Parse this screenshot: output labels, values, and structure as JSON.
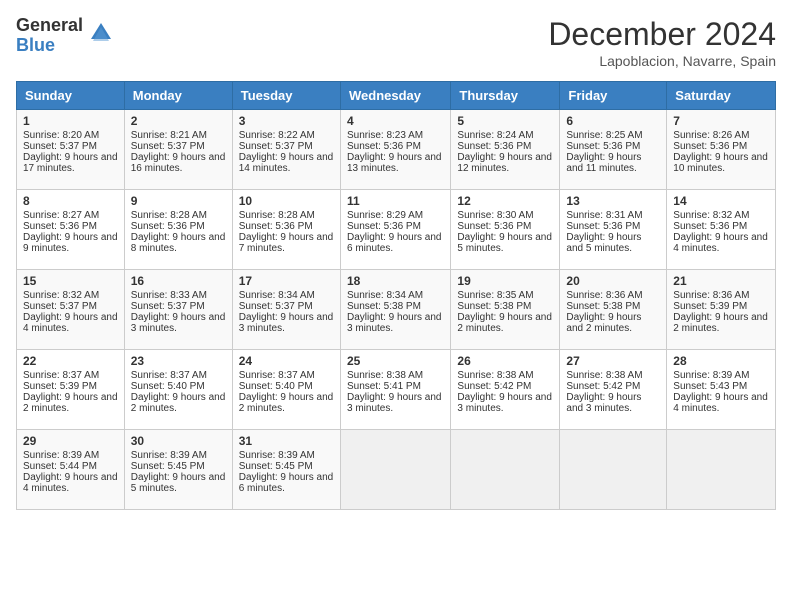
{
  "logo": {
    "general": "General",
    "blue": "Blue"
  },
  "header": {
    "month": "December 2024",
    "location": "Lapoblacion, Navarre, Spain"
  },
  "weekdays": [
    "Sunday",
    "Monday",
    "Tuesday",
    "Wednesday",
    "Thursday",
    "Friday",
    "Saturday"
  ],
  "weeks": [
    [
      {
        "day": "1",
        "sunrise": "8:20 AM",
        "sunset": "5:37 PM",
        "daylight": "9 hours and 17 minutes."
      },
      {
        "day": "2",
        "sunrise": "8:21 AM",
        "sunset": "5:37 PM",
        "daylight": "9 hours and 16 minutes."
      },
      {
        "day": "3",
        "sunrise": "8:22 AM",
        "sunset": "5:37 PM",
        "daylight": "9 hours and 14 minutes."
      },
      {
        "day": "4",
        "sunrise": "8:23 AM",
        "sunset": "5:36 PM",
        "daylight": "9 hours and 13 minutes."
      },
      {
        "day": "5",
        "sunrise": "8:24 AM",
        "sunset": "5:36 PM",
        "daylight": "9 hours and 12 minutes."
      },
      {
        "day": "6",
        "sunrise": "8:25 AM",
        "sunset": "5:36 PM",
        "daylight": "9 hours and 11 minutes."
      },
      {
        "day": "7",
        "sunrise": "8:26 AM",
        "sunset": "5:36 PM",
        "daylight": "9 hours and 10 minutes."
      }
    ],
    [
      {
        "day": "8",
        "sunrise": "8:27 AM",
        "sunset": "5:36 PM",
        "daylight": "9 hours and 9 minutes."
      },
      {
        "day": "9",
        "sunrise": "8:28 AM",
        "sunset": "5:36 PM",
        "daylight": "9 hours and 8 minutes."
      },
      {
        "day": "10",
        "sunrise": "8:28 AM",
        "sunset": "5:36 PM",
        "daylight": "9 hours and 7 minutes."
      },
      {
        "day": "11",
        "sunrise": "8:29 AM",
        "sunset": "5:36 PM",
        "daylight": "9 hours and 6 minutes."
      },
      {
        "day": "12",
        "sunrise": "8:30 AM",
        "sunset": "5:36 PM",
        "daylight": "9 hours and 5 minutes."
      },
      {
        "day": "13",
        "sunrise": "8:31 AM",
        "sunset": "5:36 PM",
        "daylight": "9 hours and 5 minutes."
      },
      {
        "day": "14",
        "sunrise": "8:32 AM",
        "sunset": "5:36 PM",
        "daylight": "9 hours and 4 minutes."
      }
    ],
    [
      {
        "day": "15",
        "sunrise": "8:32 AM",
        "sunset": "5:37 PM",
        "daylight": "9 hours and 4 minutes."
      },
      {
        "day": "16",
        "sunrise": "8:33 AM",
        "sunset": "5:37 PM",
        "daylight": "9 hours and 3 minutes."
      },
      {
        "day": "17",
        "sunrise": "8:34 AM",
        "sunset": "5:37 PM",
        "daylight": "9 hours and 3 minutes."
      },
      {
        "day": "18",
        "sunrise": "8:34 AM",
        "sunset": "5:38 PM",
        "daylight": "9 hours and 3 minutes."
      },
      {
        "day": "19",
        "sunrise": "8:35 AM",
        "sunset": "5:38 PM",
        "daylight": "9 hours and 2 minutes."
      },
      {
        "day": "20",
        "sunrise": "8:36 AM",
        "sunset": "5:38 PM",
        "daylight": "9 hours and 2 minutes."
      },
      {
        "day": "21",
        "sunrise": "8:36 AM",
        "sunset": "5:39 PM",
        "daylight": "9 hours and 2 minutes."
      }
    ],
    [
      {
        "day": "22",
        "sunrise": "8:37 AM",
        "sunset": "5:39 PM",
        "daylight": "9 hours and 2 minutes."
      },
      {
        "day": "23",
        "sunrise": "8:37 AM",
        "sunset": "5:40 PM",
        "daylight": "9 hours and 2 minutes."
      },
      {
        "day": "24",
        "sunrise": "8:37 AM",
        "sunset": "5:40 PM",
        "daylight": "9 hours and 2 minutes."
      },
      {
        "day": "25",
        "sunrise": "8:38 AM",
        "sunset": "5:41 PM",
        "daylight": "9 hours and 3 minutes."
      },
      {
        "day": "26",
        "sunrise": "8:38 AM",
        "sunset": "5:42 PM",
        "daylight": "9 hours and 3 minutes."
      },
      {
        "day": "27",
        "sunrise": "8:38 AM",
        "sunset": "5:42 PM",
        "daylight": "9 hours and 3 minutes."
      },
      {
        "day": "28",
        "sunrise": "8:39 AM",
        "sunset": "5:43 PM",
        "daylight": "9 hours and 4 minutes."
      }
    ],
    [
      {
        "day": "29",
        "sunrise": "8:39 AM",
        "sunset": "5:44 PM",
        "daylight": "9 hours and 4 minutes."
      },
      {
        "day": "30",
        "sunrise": "8:39 AM",
        "sunset": "5:45 PM",
        "daylight": "9 hours and 5 minutes."
      },
      {
        "day": "31",
        "sunrise": "8:39 AM",
        "sunset": "5:45 PM",
        "daylight": "9 hours and 6 minutes."
      },
      null,
      null,
      null,
      null
    ]
  ]
}
